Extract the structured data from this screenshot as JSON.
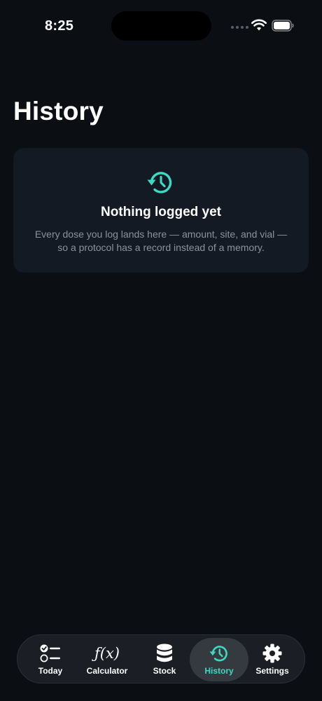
{
  "status_bar": {
    "time": "8:25"
  },
  "page": {
    "title": "History"
  },
  "empty_state": {
    "icon": "history-icon",
    "title": "Nothing logged yet",
    "description": "Every dose you log lands here — amount, site, and vial — so a protocol has a record instead of a memory."
  },
  "tabs": [
    {
      "label": "Today",
      "icon": "checklist-icon",
      "active": false
    },
    {
      "label": "Calculator",
      "icon": "function-icon",
      "active": false
    },
    {
      "label": "Stock",
      "icon": "database-icon",
      "active": false
    },
    {
      "label": "History",
      "icon": "history-icon",
      "active": true
    },
    {
      "label": "Settings",
      "icon": "gear-icon",
      "active": false
    }
  ],
  "colors": {
    "background": "#0b0e12",
    "card": "#141a23",
    "accent": "#3dd9c0",
    "muted_text": "#8a929e",
    "tab_bar": "#1b1f25",
    "tab_active": "#353a41"
  }
}
